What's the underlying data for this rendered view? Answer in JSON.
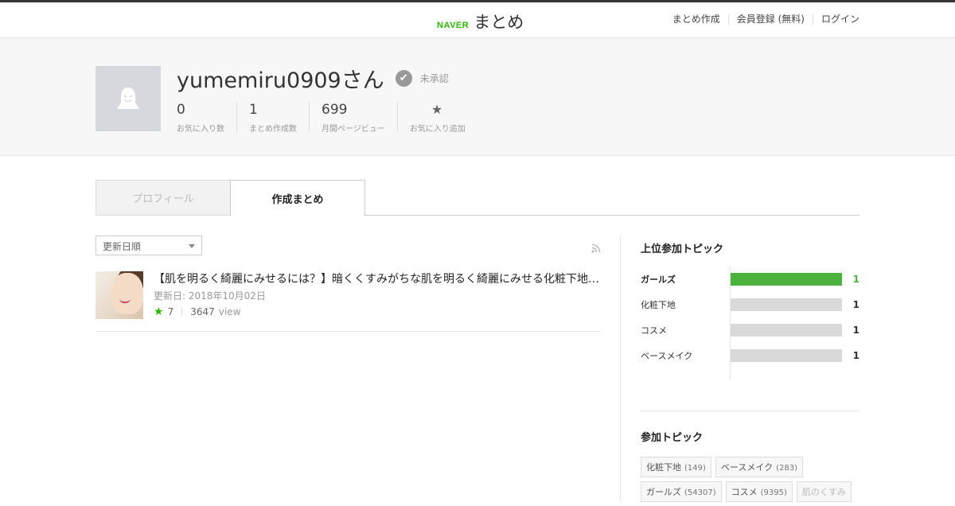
{
  "header": {
    "logo_naver": "NAVER",
    "logo_matome": "まとめ",
    "nav": [
      "まとめ作成",
      "会員登録 (無料)",
      "ログイン"
    ]
  },
  "profile": {
    "username": "yumemiru0909さん",
    "status": "未承認",
    "stats": [
      {
        "value": "0",
        "label": "お気に入り数"
      },
      {
        "value": "1",
        "label": "まとめ作成数"
      },
      {
        "value": "699",
        "label": "月間ページビュー"
      }
    ],
    "favorite_add_label": "お気に入り追加"
  },
  "tabs": {
    "profile": "プロフィール",
    "created": "作成まとめ"
  },
  "main": {
    "sort_label": "更新日順",
    "items": [
      {
        "title": "【肌を明るく綺麗にみせるには？】暗くくすみがちな肌を明るく綺麗にみせる化粧下地…",
        "date": "更新日: 2018年10月02日",
        "favorites": "7",
        "views": "3647",
        "views_unit": "view"
      }
    ]
  },
  "sidebar": {
    "top_topics_title": "上位参加トピック",
    "top_topics": [
      {
        "name": "ガールズ",
        "count": "1"
      },
      {
        "name": "化粧下地",
        "count": "1"
      },
      {
        "name": "コスメ",
        "count": "1"
      },
      {
        "name": "ベースメイク",
        "count": "1"
      }
    ],
    "topics_title": "参加トピック",
    "topics": [
      {
        "name": "化粧下地",
        "count": "(149)"
      },
      {
        "name": "ベースメイク",
        "count": "(283)"
      },
      {
        "name": "ガールズ",
        "count": "(54307)"
      },
      {
        "name": "コスメ",
        "count": "(9395)"
      },
      {
        "name": "肌のくすみ",
        "count": ""
      }
    ]
  },
  "colors": {
    "brand_green": "#2db400",
    "bar_highlight": "#4cb23e",
    "bar_default": "#d9d9d9"
  }
}
